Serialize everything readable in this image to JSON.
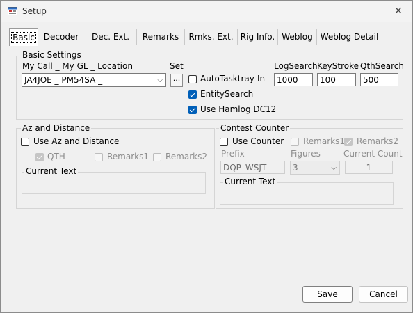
{
  "window": {
    "title": "Setup"
  },
  "tabs": [
    "Basic",
    "Decoder",
    "Dec. Ext.",
    "Remarks",
    "Rmks. Ext.",
    "Rig Info.",
    "Weblog",
    "Weblog Detail"
  ],
  "basic_settings": {
    "legend": "Basic Settings",
    "mycall_label": "My Call _ My GL _ Location",
    "mycall_value": "JA4JOE _ PM54SA _",
    "set_label": "Set",
    "set_button": "...",
    "autotasktray": {
      "label": "AutoTasktray-In",
      "checked": false
    },
    "entitysearch": {
      "label": "EntitySearch",
      "checked": true
    },
    "usehamlog": {
      "label": "Use Hamlog DC12",
      "checked": true
    },
    "logsearch_label": "LogSearch",
    "logsearch_value": "1000",
    "keystroke_label": "KeyStroke",
    "keystroke_value": "100",
    "qthsearch_label": "QthSearch",
    "qthsearch_value": "500"
  },
  "az_distance": {
    "legend": "Az and Distance",
    "use_label": "Use Az and Distance",
    "qth_label": "QTH",
    "remarks1_label": "Remarks1",
    "remarks2_label": "Remarks2",
    "current_text_label": "Current Text"
  },
  "contest_counter": {
    "legend": "Contest Counter",
    "use_label": "Use Counter",
    "remarks1_label": "Remarks1",
    "remarks2_label": "Remarks2",
    "prefix_label": "Prefix",
    "prefix_value": "DQP_WSJT-",
    "figures_label": "Figures",
    "figures_value": "3",
    "current_count_label": "Current Count",
    "current_count_value": "1",
    "current_text_label": "Current Text"
  },
  "buttons": {
    "save": "Save",
    "cancel": "Cancel"
  }
}
